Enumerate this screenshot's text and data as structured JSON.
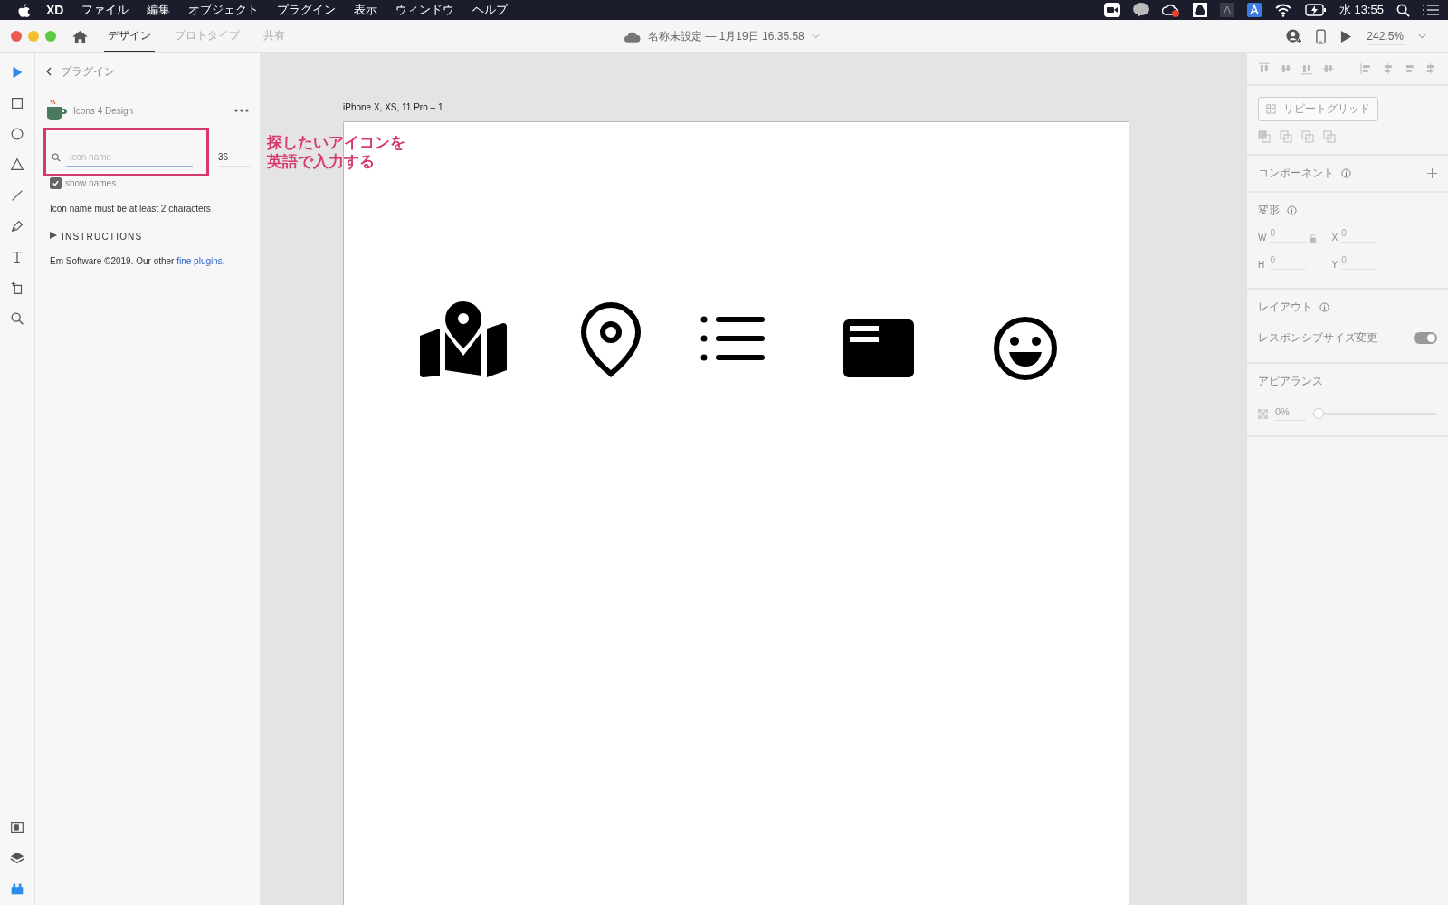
{
  "menu_bar": {
    "app": "XD",
    "items": [
      "ファイル",
      "編集",
      "オブジェクト",
      "プラグイン",
      "表示",
      "ウィンドウ",
      "ヘルプ"
    ],
    "clock": "水 13:55"
  },
  "toolbar": {
    "tabs": [
      {
        "label": "デザイン",
        "selected": true
      },
      {
        "label": "プロトタイプ",
        "selected": false
      },
      {
        "label": "共有",
        "selected": false
      }
    ],
    "document_title": "名称未設定 — 1月19日 16.35.58",
    "zoom": "242.5%"
  },
  "tools": [
    {
      "kind": "select",
      "selected": true
    },
    {
      "kind": "rectangle",
      "selected": false
    },
    {
      "kind": "ellipse",
      "selected": false
    },
    {
      "kind": "polygon",
      "selected": false
    },
    {
      "kind": "line",
      "selected": false
    },
    {
      "kind": "pen",
      "selected": false
    },
    {
      "kind": "text",
      "selected": false
    },
    {
      "kind": "artboard",
      "selected": false
    },
    {
      "kind": "zoom",
      "selected": false
    }
  ],
  "bottom_tools": [
    {
      "kind": "assets",
      "selected": false
    },
    {
      "kind": "layers",
      "selected": false
    },
    {
      "kind": "plugins",
      "selected": true
    }
  ],
  "plugin_panel": {
    "back_label": "プラグイン",
    "plugin_name": "Icons 4 Design",
    "search": {
      "placeholder": "icon name"
    },
    "size": "36",
    "show_names": {
      "label": "show names",
      "checked": true
    },
    "message": "Icon name must be at least 2 characters",
    "instructions": {
      "label": "INSTRUCTIONS",
      "expanded": false
    },
    "footer": "Em Software ©2019. Our other ",
    "footer_link": "fine plugins",
    "footer_end": "."
  },
  "annotation": {
    "lines": [
      "探したいアイコンを",
      "英語で入力する"
    ]
  },
  "artboard": {
    "label": "iPhone X, XS, 11 Pro – 1",
    "icons": [
      {
        "kind": "map"
      },
      {
        "kind": "pin"
      },
      {
        "kind": "list"
      },
      {
        "kind": "card"
      },
      {
        "kind": "smiley"
      }
    ]
  },
  "right_panel": {
    "repeat_grid": "リピートグリッド",
    "component": "コンポーネント",
    "transform": {
      "title": "変形",
      "fields": [
        {
          "label": "W",
          "value": "0"
        },
        {
          "label": "X",
          "value": "0"
        },
        {
          "label": "H",
          "value": "0"
        },
        {
          "label": "Y",
          "value": "0"
        }
      ]
    },
    "layout": {
      "title": "レイアウト",
      "responsive": {
        "label": "レスポンシブサイズ変更",
        "on": true
      }
    },
    "appearance": {
      "title": "アピアランス",
      "opacity": "0%",
      "level": 0
    }
  }
}
